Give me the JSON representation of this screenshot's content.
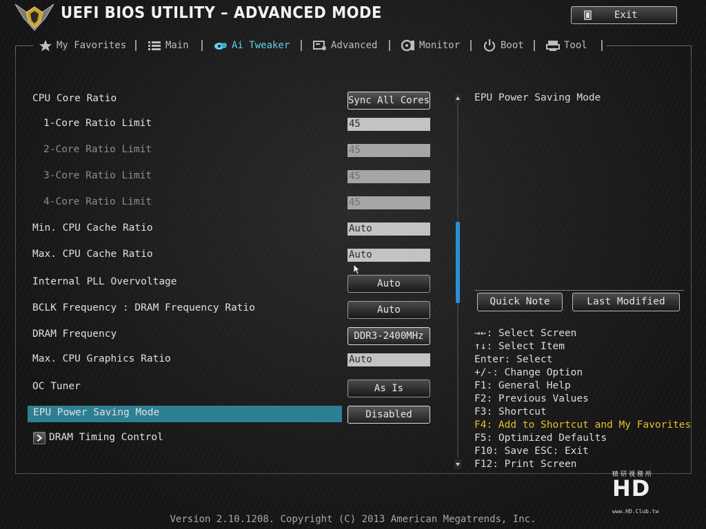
{
  "header": {
    "title": "UEFI BIOS UTILITY – ADVANCED MODE",
    "exit_label": "Exit"
  },
  "nav": {
    "tabs": [
      {
        "label": "My Favorites",
        "icon": "star-icon",
        "active": false
      },
      {
        "label": "Main",
        "icon": "list-icon",
        "active": false
      },
      {
        "label": "Ai Tweaker",
        "icon": "tweaker-icon",
        "active": true
      },
      {
        "label": "Advanced",
        "icon": "advanced-icon",
        "active": false
      },
      {
        "label": "Monitor",
        "icon": "monitor-icon",
        "active": false
      },
      {
        "label": "Boot",
        "icon": "power-icon",
        "active": false
      },
      {
        "label": "Tool",
        "icon": "tool-icon",
        "active": false
      }
    ],
    "active_color": "#5fd3f0"
  },
  "settings": [
    {
      "label": "CPU Core Ratio",
      "control": "button",
      "value": "Sync All Cores"
    },
    {
      "label": "1-Core Ratio Limit",
      "control": "field",
      "value": "45"
    },
    {
      "label": "2-Core Ratio Limit",
      "control": "field-disabled",
      "value": "45"
    },
    {
      "label": "3-Core Ratio Limit",
      "control": "field-disabled",
      "value": "45"
    },
    {
      "label": "4-Core Ratio Limit",
      "control": "field-disabled",
      "value": "45"
    },
    {
      "label": "Min. CPU Cache Ratio",
      "control": "field",
      "value": "Auto"
    },
    {
      "label": "Max. CPU Cache Ratio",
      "control": "field",
      "value": "Auto"
    },
    {
      "label": "Internal PLL Overvoltage",
      "control": "button",
      "value": "Auto"
    },
    {
      "label": "BCLK Frequency : DRAM Frequency Ratio",
      "control": "button",
      "value": "Auto"
    },
    {
      "label": "DRAM Frequency",
      "control": "button",
      "value": "DDR3-2400MHz"
    },
    {
      "label": "Max. CPU Graphics Ratio",
      "control": "field",
      "value": "Auto"
    },
    {
      "label": "OC Tuner",
      "control": "button",
      "value": "As Is"
    },
    {
      "label": "EPU Power Saving Mode",
      "control": "button",
      "value": "Disabled",
      "selected": true
    },
    {
      "label": "DRAM Timing Control",
      "control": "submenu"
    }
  ],
  "selection_color": "#2e7f93",
  "scrollbar": {
    "color": "#2d8fd3"
  },
  "help": {
    "title": "EPU Power Saving Mode",
    "quick_note": "Quick Note",
    "last_modified": "Last Modified",
    "keys": [
      "→←: Select Screen",
      "↑↓: Select Item",
      "Enter: Select",
      "+/-: Change Option",
      "F1: General Help",
      "F2: Previous Values",
      "F3: Shortcut",
      "F4: Add to Shortcut and My Favorites",
      "F5: Optimized Defaults",
      "F10: Save  ESC: Exit",
      "F12: Print Screen"
    ],
    "highlight_color": "#e6c02b"
  },
  "footer": {
    "version": "Version 2.10.1208. Copyright (C) 2013 American Megatrends, Inc."
  },
  "watermark": {
    "top": "精研視務所",
    "logo": "HD",
    "url": "www.HD.Club.tw"
  }
}
